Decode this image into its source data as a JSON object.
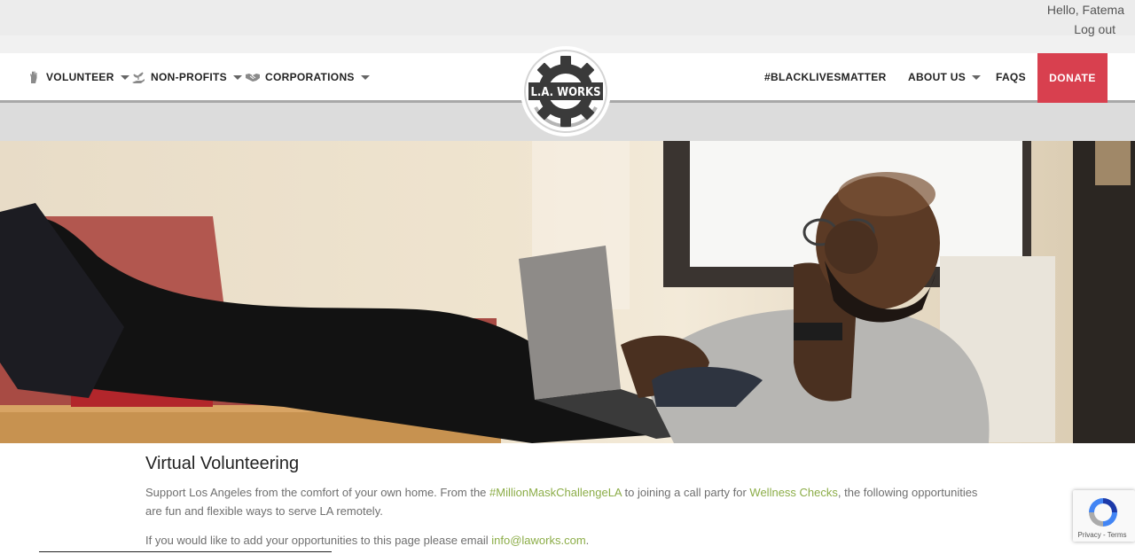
{
  "user": {
    "greeting": "Hello, Fatema",
    "logout_label": "Log out"
  },
  "nav": {
    "left": [
      {
        "label": "VOLUNTEER",
        "icon": "raised-hand-icon"
      },
      {
        "label": "NON-PROFITS",
        "icon": "sprout-hand-icon"
      },
      {
        "label": "CORPORATIONS",
        "icon": "handshake-icon"
      }
    ],
    "right": [
      {
        "label": "#BLACKLIVESMATTER"
      },
      {
        "label": "ABOUT US"
      },
      {
        "label": "FAQS"
      }
    ],
    "donate_label": "DONATE",
    "logo_text": "L.A. WORKS"
  },
  "colors": {
    "accent": "#d8404f",
    "link": "#8cad48",
    "logo": "#3a3a3a"
  },
  "content": {
    "title": "Virtual Volunteering",
    "intro_1": "Support Los Angeles from the comfort of your own home. From the ",
    "link_1": "#MillionMaskChallengeLA",
    "intro_2": " to joining a call party for ",
    "link_2": "Wellness Checks",
    "intro_3": ", the following opportunities are fun and flexible ways to serve LA remotely.",
    "email_text": "If you would like to add your opportunities to this page please email ",
    "email_link": "info@laworks.com",
    "email_end": "."
  },
  "recaptcha": {
    "legal": "Privacy - Terms"
  }
}
